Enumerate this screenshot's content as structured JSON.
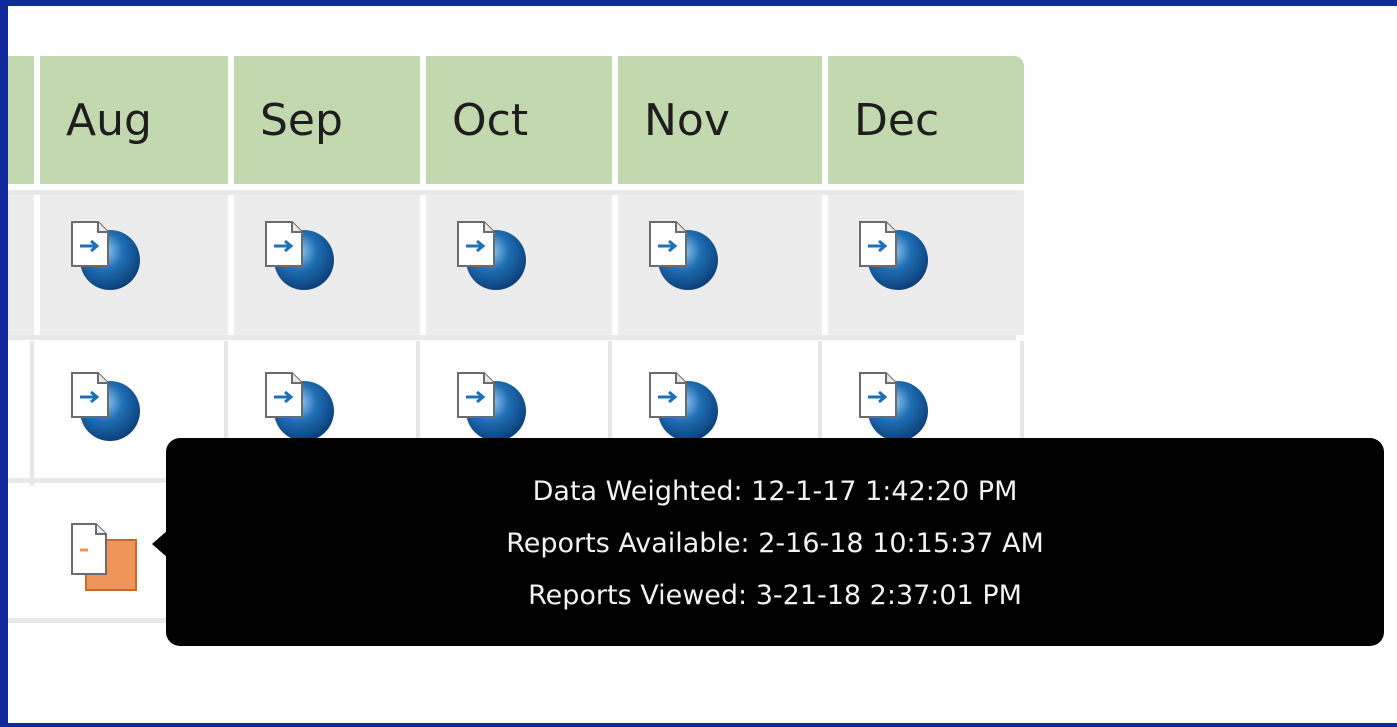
{
  "table": {
    "months": [
      "Aug",
      "Sep",
      "Oct",
      "Nov",
      "Dec"
    ],
    "rows": [
      {
        "icons": [
          "report-available-icon",
          "report-available-icon",
          "report-available-icon",
          "report-available-icon",
          "report-available-icon"
        ]
      },
      {
        "icons": [
          "report-available-icon",
          "report-available-icon",
          "report-available-icon",
          "report-available-icon",
          "report-available-icon"
        ]
      },
      {
        "icons": [
          "report-pending-icon"
        ]
      }
    ]
  },
  "tooltip": {
    "line1": "Data Weighted: 12-1-17 1:42:20 PM",
    "line2": "Reports Available: 2-16-18 10:15:37 AM",
    "line3": "Reports Viewed: 3-21-18 2:37:01 PM"
  },
  "colors": {
    "frame": "#102a9c",
    "header": "#c2d8ae",
    "row_alt": "#ececec",
    "tooltip_bg": "#000000",
    "icon_blue": "#1f6fb5",
    "icon_orange": "#f0955a"
  }
}
